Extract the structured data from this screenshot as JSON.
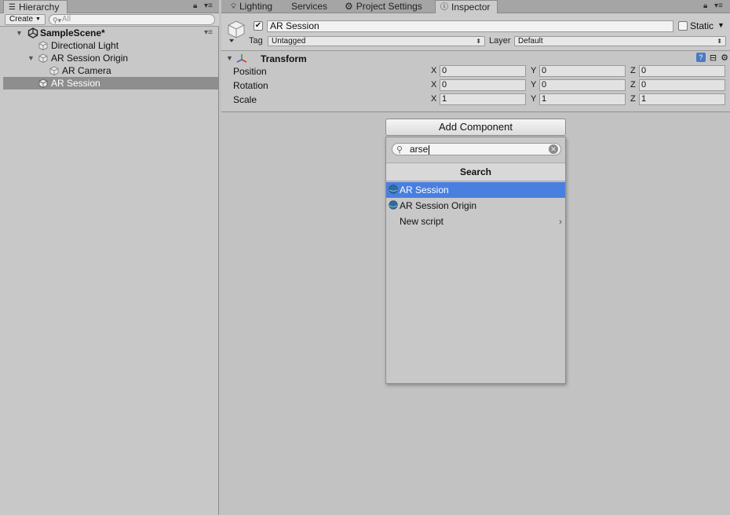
{
  "hierarchy": {
    "tab_label": "Hierarchy",
    "create_label": "Create",
    "search_placeholder": "All",
    "items": [
      {
        "label": "SampleScene*"
      },
      {
        "label": "Directional Light"
      },
      {
        "label": "AR Session Origin"
      },
      {
        "label": "AR Camera"
      },
      {
        "label": "AR Session"
      }
    ]
  },
  "tabs": {
    "lighting": "Lighting",
    "services": "Services",
    "project_settings": "Project Settings",
    "inspector": "Inspector"
  },
  "inspector": {
    "object_name": "AR Session",
    "active_checked": "✔",
    "static_label": "Static",
    "tag_label": "Tag",
    "tag_value": "Untagged",
    "layer_label": "Layer",
    "layer_value": "Default",
    "transform": {
      "title": "Transform",
      "rows": [
        {
          "name": "Position",
          "x": "0",
          "y": "0",
          "z": "0"
        },
        {
          "name": "Rotation",
          "x": "0",
          "y": "0",
          "z": "0"
        },
        {
          "name": "Scale",
          "x": "1",
          "y": "1",
          "z": "1"
        }
      ],
      "axis": {
        "x": "X",
        "y": "Y",
        "z": "Z"
      }
    }
  },
  "add_component": {
    "button_label": "Add Component",
    "search_value": "arse",
    "header": "Search",
    "results": [
      {
        "label": "AR Session"
      },
      {
        "label": "AR Session Origin"
      },
      {
        "label": "New script"
      }
    ]
  },
  "colors": {
    "selection": "#4a7fe0",
    "hierarchy_selected": "#8e8e8e"
  }
}
